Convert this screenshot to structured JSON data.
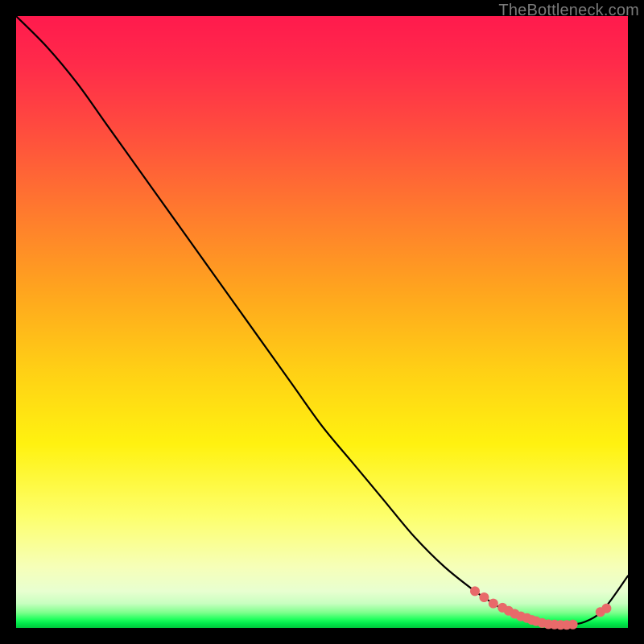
{
  "watermark": "TheBottleneck.com",
  "colors": {
    "background": "#000000",
    "curve": "#000000",
    "marker": "#e86a6a"
  },
  "chart_data": {
    "type": "line",
    "title": "",
    "xlabel": "",
    "ylabel": "",
    "xlim": [
      0,
      100
    ],
    "ylim": [
      0,
      100
    ],
    "grid": false,
    "x": [
      0,
      5,
      10,
      15,
      20,
      25,
      30,
      35,
      40,
      45,
      50,
      55,
      60,
      65,
      70,
      75,
      78,
      80,
      83,
      85,
      87,
      90,
      93,
      96,
      100
    ],
    "y": [
      100,
      95,
      89,
      82,
      75,
      68,
      61,
      54,
      47,
      40,
      33,
      27,
      21,
      15,
      10,
      6,
      4,
      2.8,
      1.6,
      1.0,
      0.6,
      0.5,
      1.0,
      3.0,
      8.5
    ],
    "markers": {
      "x": [
        75,
        76.5,
        78,
        79.5,
        80.5,
        81.5,
        82.5,
        83.5,
        84.3,
        85,
        86,
        87,
        88,
        89,
        90,
        91,
        95.5,
        96.5
      ],
      "y": [
        6.0,
        5.0,
        4.0,
        3.3,
        2.8,
        2.3,
        1.9,
        1.6,
        1.3,
        1.1,
        0.8,
        0.6,
        0.55,
        0.5,
        0.5,
        0.55,
        2.6,
        3.2
      ]
    }
  }
}
